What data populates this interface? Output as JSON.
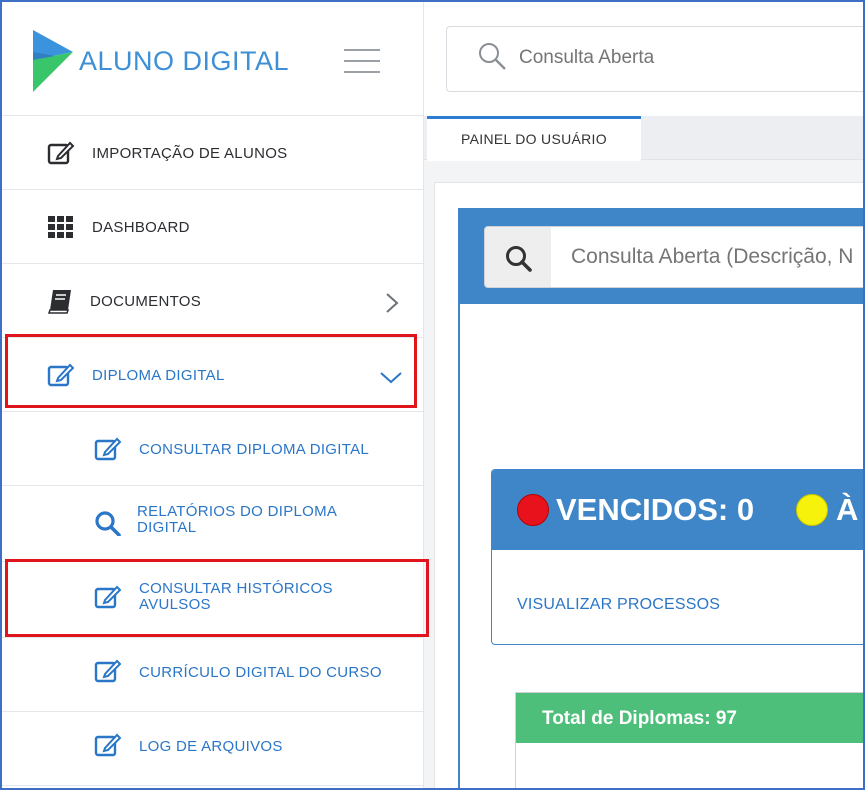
{
  "brand": {
    "name": "ALUNO DIGITAL"
  },
  "header": {
    "search_placeholder": "Consulta Aberta"
  },
  "tabs": [
    {
      "label": "PAINEL DO USUÁRIO"
    }
  ],
  "sidebar": {
    "items": [
      {
        "label": "IMPORTAÇÃO DE ALUNOS",
        "icon": "edit-icon"
      },
      {
        "label": "DASHBOARD",
        "icon": "grid-icon"
      },
      {
        "label": "DOCUMENTOS",
        "icon": "book-icon"
      },
      {
        "label": "DIPLOMA DIGITAL",
        "icon": "edit-icon",
        "expanded": true
      },
      {
        "label": "CONSULTAR DIPLOMA DIGITAL",
        "icon": "edit-icon"
      },
      {
        "label_line1": "RELATÓRIOS DO DIPLOMA",
        "label_line2": "DIGITAL",
        "icon": "search-icon"
      },
      {
        "label_line1": "CONSULTAR HISTÓRICOS",
        "label_line2": "AVULSOS",
        "icon": "edit-icon"
      },
      {
        "label": "CURRÍCULO DIGITAL DO CURSO",
        "icon": "edit-icon"
      },
      {
        "label": "LOG DE ARQUIVOS",
        "icon": "edit-icon"
      }
    ]
  },
  "panel": {
    "search_placeholder": "Consulta Aberta (Descrição, N",
    "status": {
      "vencidos_label": "VENCIDOS: 0",
      "next_label": "À",
      "link": "VISUALIZAR PROCESSOS"
    },
    "diplomas": {
      "title": "Total de Diplomas: 97"
    }
  },
  "colors": {
    "accent_blue": "#3e86c8",
    "link_blue": "#2a76c8",
    "highlight_red": "#e0141d",
    "status_red": "#e8121c",
    "status_yellow": "#f6f20c",
    "green": "#4ebf7b"
  }
}
